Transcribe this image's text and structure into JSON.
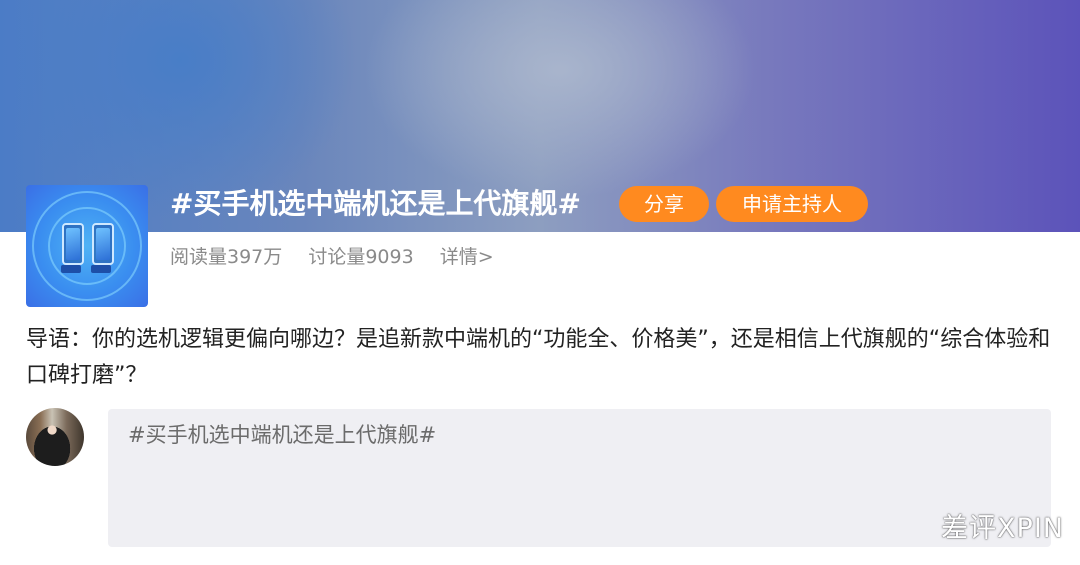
{
  "topic": {
    "title": "#买手机选中端机还是上代旗舰#",
    "logo_icon": "phones-icon"
  },
  "actions": {
    "share_label": "分享",
    "apply_host_label": "申请主持人"
  },
  "stats": {
    "reads": "阅读量397万",
    "discussions": "讨论量9093",
    "details": "详情>"
  },
  "intro_text": "导语：你的选机逻辑更偏向哪边？是追新款中端机的“功能全、价格美”，还是相信上代旗舰的“综合体验和口碑打磨”？",
  "composer": {
    "value": "#买手机选中端机还是上代旗舰#"
  },
  "watermark": "差评XPIN",
  "colors": {
    "accent_orange": "#ff8a1f",
    "muted_text": "#8a8a8a",
    "compose_bg": "#efeff3"
  }
}
